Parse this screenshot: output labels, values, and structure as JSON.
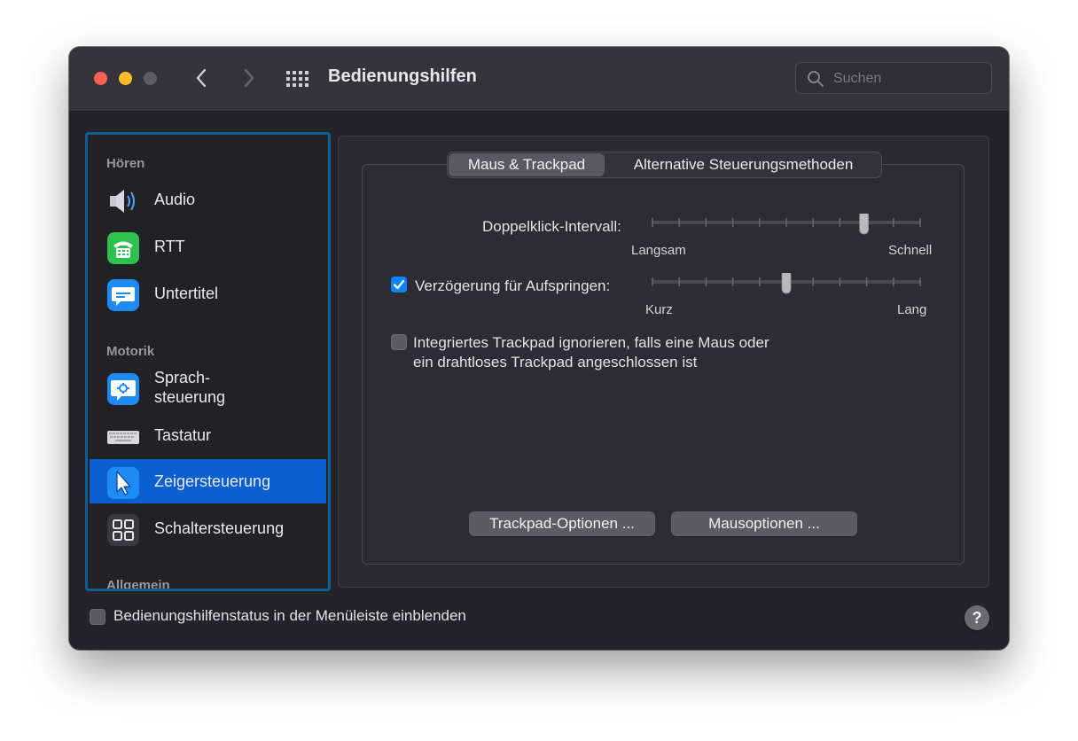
{
  "window": {
    "title": "Bedienungshilfen",
    "search_placeholder": "Suchen"
  },
  "sidebar": {
    "sections": [
      {
        "label": "Hören"
      },
      {
        "label": "Motorik"
      },
      {
        "label": "Allgemein"
      }
    ],
    "items": [
      {
        "label": "Audio",
        "icon": "speaker-icon"
      },
      {
        "label": "RTT",
        "icon": "teletype-icon"
      },
      {
        "label": "Untertitel",
        "icon": "subtitles-icon"
      },
      {
        "label": "Sprach-\nsteuerung",
        "icon": "voice-control-icon"
      },
      {
        "label": "Tastatur",
        "icon": "keyboard-icon"
      },
      {
        "label": "Zeigersteuerung",
        "icon": "pointer-icon",
        "selected": true
      },
      {
        "label": "Schaltersteuerung",
        "icon": "switch-control-icon"
      }
    ]
  },
  "tabs": [
    {
      "label": "Maus & Trackpad",
      "selected": true
    },
    {
      "label": "Alternative Steuerungsmethoden",
      "selected": false
    }
  ],
  "double_click": {
    "label": "Doppelklick-Intervall:",
    "min_label": "Langsam",
    "max_label": "Schnell",
    "value_fraction": 0.79
  },
  "spring_delay": {
    "label": "Verzögerung für Aufspringen:",
    "checked": true,
    "min_label": "Kurz",
    "max_label": "Lang",
    "value_fraction": 0.5
  },
  "ignore_trackpad": {
    "label_line1": "Integriertes Trackpad ignorieren, falls eine Maus oder",
    "label_line2": "ein drahtloses Trackpad angeschlossen ist",
    "checked": false
  },
  "buttons": {
    "trackpad_options": "Trackpad-Optionen ...",
    "mouse_options": "Mausoptionen ..."
  },
  "footer": {
    "status_label": "Bedienungshilfenstatus in der Menüleiste einblenden",
    "status_checked": false,
    "help": "?"
  },
  "colors": {
    "accent": "#0a84ff",
    "selection": "#0b5fd0",
    "sidebar_focus": "#0e5f95"
  }
}
